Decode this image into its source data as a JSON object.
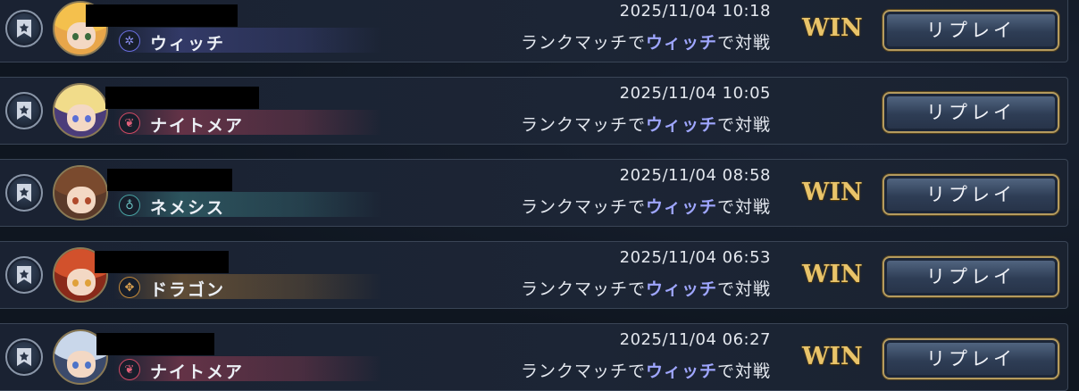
{
  "matches": [
    {
      "timestamp": "2025/11/04 10:18",
      "opponent_class": "ウィッチ",
      "desc_prefix": "ランクマッチで",
      "desc_class": "ウィッチ",
      "desc_suffix": "で対戦",
      "result": "WIN",
      "replay_label": "リプレイ",
      "class_icon": "witch-emblem-icon",
      "class_icon_glyph": "✲",
      "class_color": "#6a6ee0"
    },
    {
      "timestamp": "2025/11/04 10:05",
      "opponent_class": "ナイトメア",
      "desc_prefix": "ランクマッチで",
      "desc_class": "ウィッチ",
      "desc_suffix": "で対戦",
      "result": "",
      "replay_label": "リプレイ",
      "class_icon": "nightmare-emblem-icon",
      "class_icon_glyph": "❦",
      "class_color": "#d14a64"
    },
    {
      "timestamp": "2025/11/04 08:58",
      "opponent_class": "ネメシス",
      "desc_prefix": "ランクマッチで",
      "desc_class": "ウィッチ",
      "desc_suffix": "で対戦",
      "result": "WIN",
      "replay_label": "リプレイ",
      "class_icon": "nemesis-emblem-icon",
      "class_icon_glyph": "♁",
      "class_color": "#49a3a3"
    },
    {
      "timestamp": "2025/11/04 06:53",
      "opponent_class": "ドラゴン",
      "desc_prefix": "ランクマッチで",
      "desc_class": "ウィッチ",
      "desc_suffix": "で対戦",
      "result": "WIN",
      "replay_label": "リプレイ",
      "class_icon": "dragon-emblem-icon",
      "class_icon_glyph": "✥",
      "class_color": "#c58a3a"
    },
    {
      "timestamp": "2025/11/04 06:27",
      "opponent_class": "ナイトメア",
      "desc_prefix": "ランクマッチで",
      "desc_class": "ウィッチ",
      "desc_suffix": "で対戦",
      "result": "WIN",
      "replay_label": "リプレイ",
      "class_icon": "nightmare-emblem-icon",
      "class_icon_glyph": "❦",
      "class_color": "#d14a64"
    }
  ],
  "favorite_icon": "bookmark-star-icon",
  "colors": {
    "win_gold": "#e9c46a",
    "highlight_class": "#9fa6ff",
    "button_border": "#b59b5e"
  }
}
